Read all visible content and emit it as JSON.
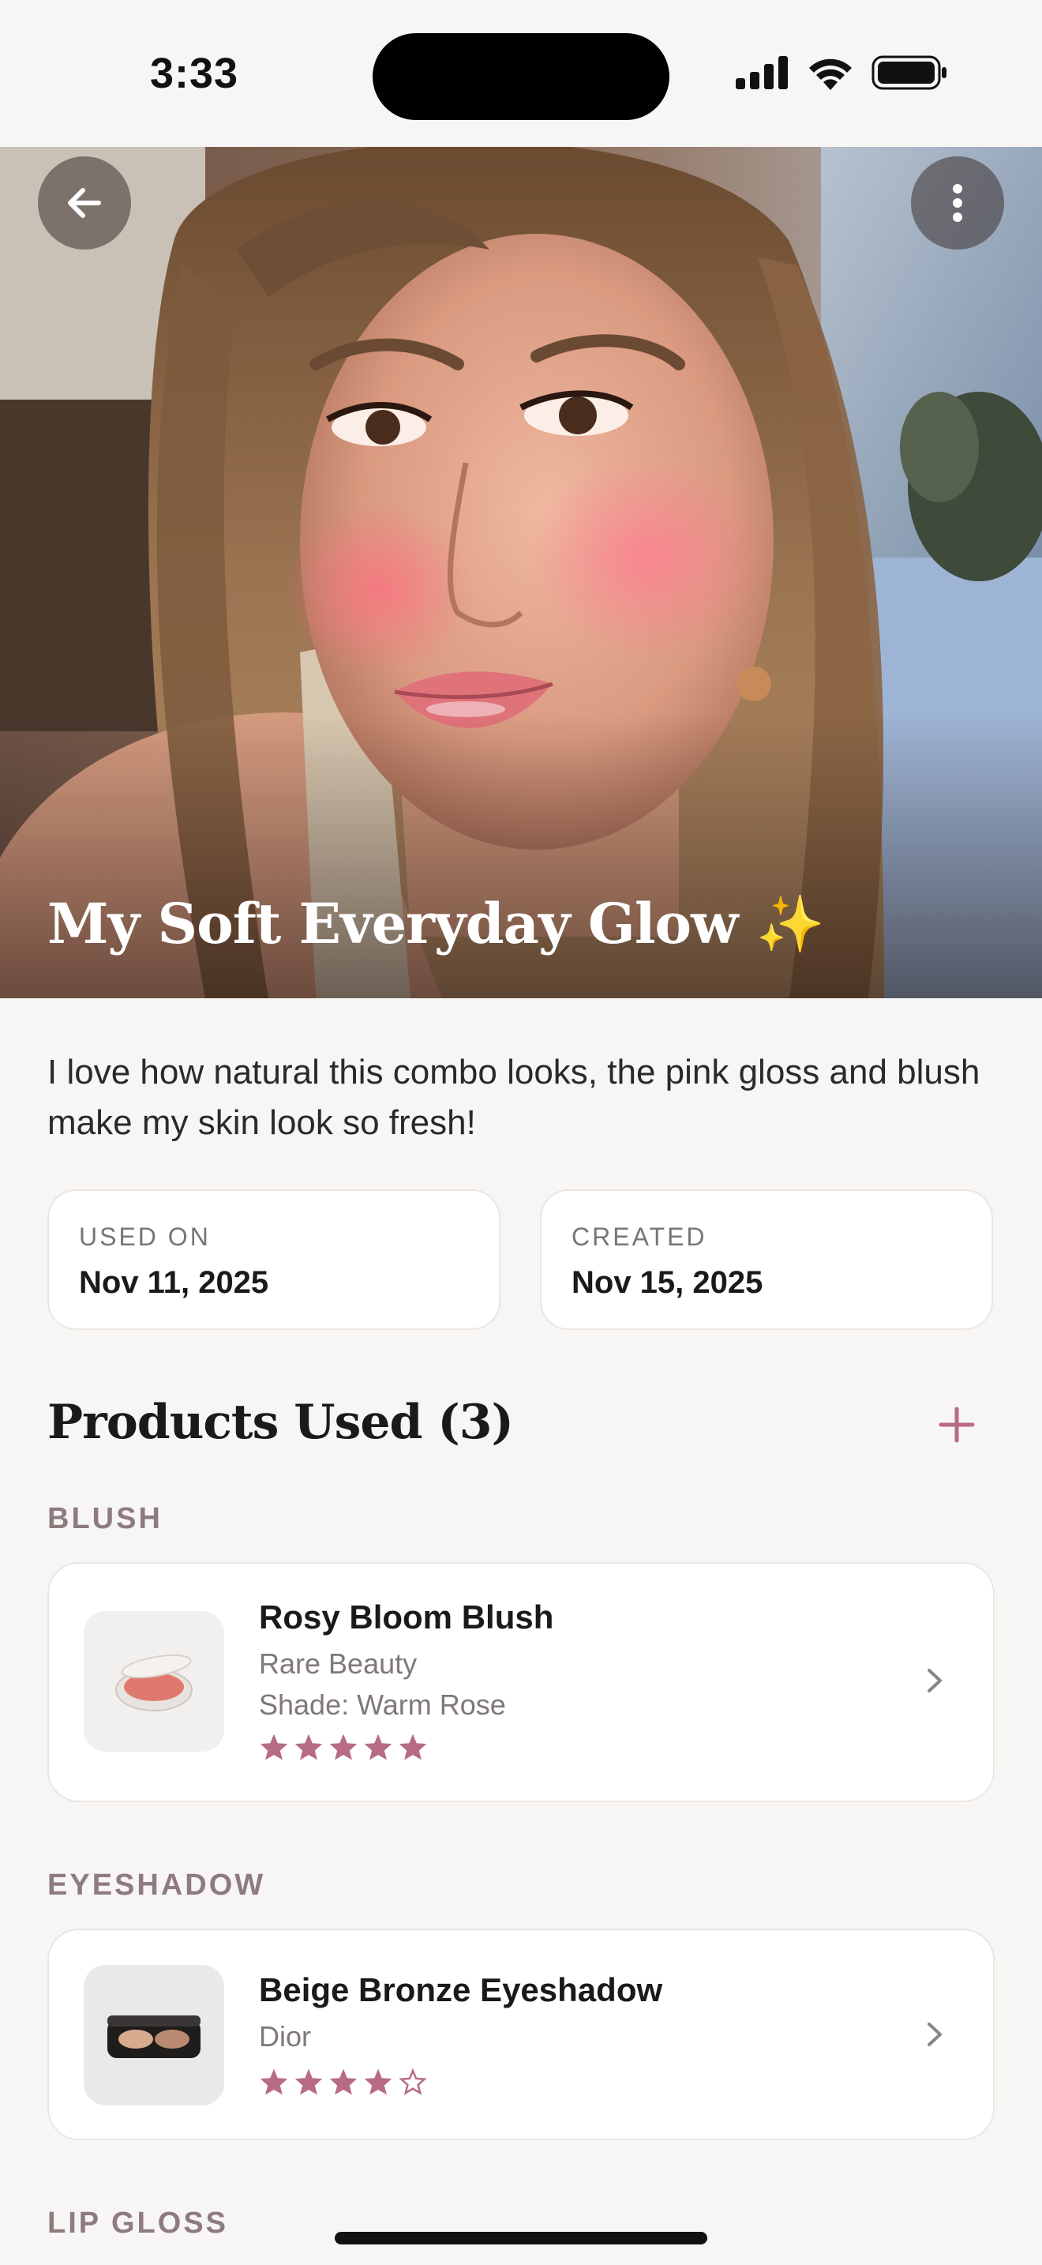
{
  "status_bar": {
    "time": "3:33"
  },
  "hero": {
    "title": "My Soft Everyday Glow ✨",
    "image": "selfie-photo"
  },
  "description": "I love how natural this combo looks, the pink gloss and blush make my skin look so fresh!",
  "dates": {
    "used_on_label": "USED ON",
    "used_on_value": "Nov 11, 2025",
    "created_label": "CREATED",
    "created_value": "Nov 15, 2025"
  },
  "products_section": {
    "title": "Products Used (3)"
  },
  "categories": [
    {
      "label": "BLUSH",
      "product": {
        "name": "Rosy Bloom Blush",
        "brand": "Rare Beauty",
        "shade": "Shade: Warm Rose",
        "rating": 5,
        "max_rating": 5
      }
    },
    {
      "label": "EYESHADOW",
      "product": {
        "name": "Beige Bronze Eyeshadow",
        "brand": "Dior",
        "rating": 4,
        "max_rating": 5
      }
    },
    {
      "label": "LIP GLOSS"
    }
  ],
  "colors": {
    "accent": "#b86b84",
    "background": "#f8f6f4",
    "category_label": "#8e7b7f"
  }
}
